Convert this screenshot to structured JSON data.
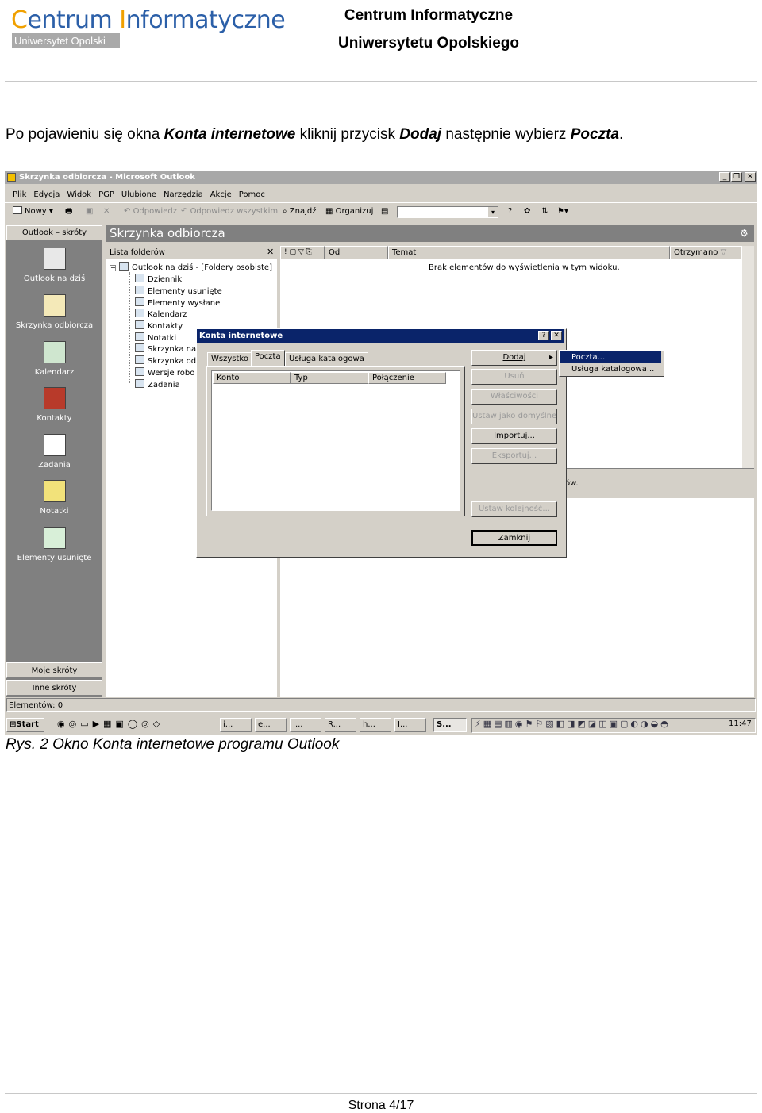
{
  "header": {
    "logo_part1": "Centrum",
    "logo_part2": "Informatyczne",
    "logo_sub": "Uniwersytet Opolski",
    "line1": "Centrum Informatyczne",
    "line2": "Uniwersytetu Opolskiego"
  },
  "intro": {
    "t1": "Po pojawieniu się okna ",
    "b1": "Konta internetowe",
    "t2": " kliknij przycisk ",
    "b2": "Dodaj",
    "t3": " następnie wybierz ",
    "b3": "Poczta",
    "t4": "."
  },
  "outlook": {
    "title": "Skrzynka odbiorcza - Microsoft Outlook",
    "menu": [
      "Plik",
      "Edycja",
      "Widok",
      "PGP",
      "Ulubione",
      "Narzędzia",
      "Akcje",
      "Pomoc"
    ],
    "toolbar": {
      "new": "Nowy",
      "reply": "Odpowiedz",
      "reply_all": "Odpowiedz wszystkim",
      "find": "Znajdź",
      "organize": "Organizuj"
    },
    "shortcuts_title": "Outlook – skróty",
    "shortcuts": [
      "Outlook na dziś",
      "Skrzynka odbiorcza",
      "Kalendarz",
      "Kontakty",
      "Zadania",
      "Notatki",
      "Elementy usunięte"
    ],
    "my_shortcuts": "Moje skróty",
    "other_shortcuts": "Inne skróty",
    "panel_title": "Skrzynka odbiorcza",
    "folder_list_title": "Lista folderów",
    "folder_root": "Outlook na dziś - [Foldery osobiste]",
    "folders": [
      "Dziennik",
      "Elementy usunięte",
      "Elementy wysłane",
      "Kalendarz",
      "Kontakty",
      "Notatki",
      "Skrzynka nad",
      "Skrzynka odb",
      "Wersje robo",
      "Zadania"
    ],
    "columns": {
      "from": "Od",
      "subject": "Temat",
      "received": "Otrzymano"
    },
    "empty_message": "Brak elementów do wyświetlenia w tym widoku.",
    "preview_fragment": "ów.",
    "status": "Elementów: 0"
  },
  "dialog": {
    "title": "Konta internetowe",
    "tabs": [
      "Wszystko",
      "Poczta",
      "Usługa katalogowa"
    ],
    "columns": [
      "Konto",
      "Typ",
      "Połączenie"
    ],
    "buttons": {
      "add": "Dodaj",
      "remove": "Usuń",
      "properties": "Właściwości",
      "set_default": "Ustaw jako domyślne",
      "import": "Importuj...",
      "export": "Eksportuj...",
      "set_order": "Ustaw kolejność...",
      "close": "Zamknij"
    },
    "popup": [
      "Poczta...",
      "Usługa katalogowa..."
    ]
  },
  "taskbar": {
    "start": "Start",
    "tasks": [
      "i...",
      "e...",
      "I...",
      "R...",
      "h...",
      "I...",
      "S..."
    ],
    "clock": "11:47"
  },
  "caption": "Rys. 2 Okno Konta internetowe programu Outlook",
  "footer": {
    "page": "Strona  4/17"
  },
  "colors": {
    "accent_orange": "#f0a000",
    "logo_blue": "#2b5fa8",
    "dialog_title": "#0a246a",
    "highlight": "#0a246a"
  }
}
